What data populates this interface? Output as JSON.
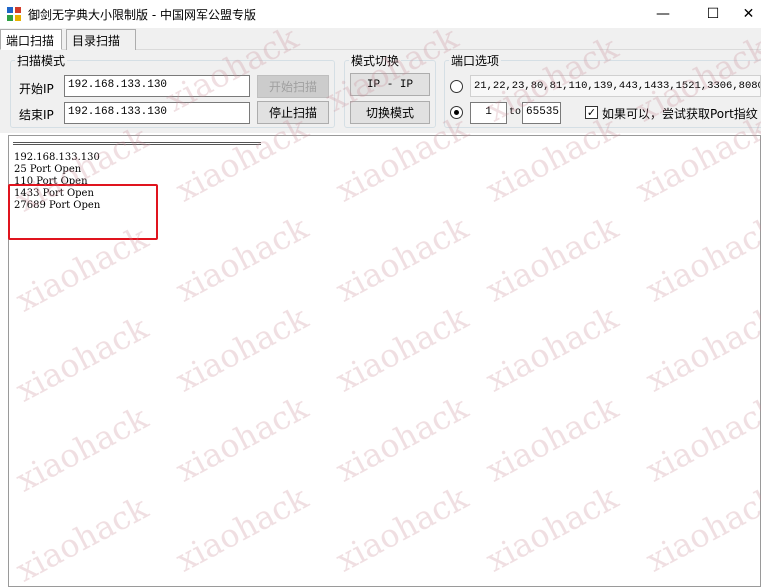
{
  "window": {
    "title": "御剑无字典大小限制版 - 中国网军公盟专版",
    "minimize_glyph": "—",
    "maximize_glyph": "☐",
    "close_glyph": "✕"
  },
  "tabs": [
    {
      "label": "端口扫描",
      "active": true
    },
    {
      "label": "目录扫描",
      "active": false
    }
  ],
  "scan_mode": {
    "legend": "扫描模式",
    "start_ip_label": "开始IP",
    "start_ip_value": "192.168.133.130",
    "end_ip_label": "结束IP",
    "end_ip_value": "192.168.133.130",
    "start_button": "开始扫描",
    "stop_button": "停止扫描"
  },
  "mode_switch": {
    "legend": "模式切换",
    "mode_display": "IP - IP",
    "switch_button": "切换模式"
  },
  "port_options": {
    "legend": "端口选项",
    "preset_ports": "21,22,23,80,81,110,139,443,1433,1521,3306,8080",
    "range_from": "1",
    "range_to_label": "to",
    "range_to": "65535",
    "fingerprint_label": "如果可以，尝试获取Port指纹",
    "fingerprint_checked": true,
    "selected_radio": "range"
  },
  "output": {
    "lines": [
      "192.168.133.130",
      "25 Port Open",
      "110 Port Open",
      "1433 Port Open",
      "27689 Port Open"
    ]
  },
  "watermark_text": "xiaohack",
  "colors": {
    "highlight": "#e0141e"
  }
}
